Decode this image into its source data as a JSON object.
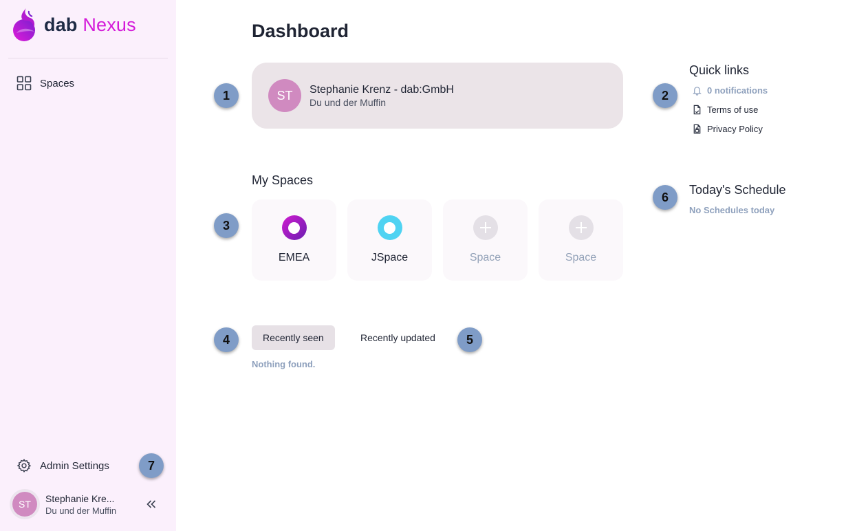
{
  "brand": {
    "name_part1": "dab",
    "name_part2": "Nexus"
  },
  "sidebar": {
    "nav": [
      {
        "label": "Spaces",
        "icon": "grid-icon"
      }
    ],
    "admin": {
      "label": "Admin Settings",
      "icon": "gear-icon"
    },
    "user": {
      "initials": "ST",
      "name": "Stephanie Kre...",
      "org": "Du und der Muffin"
    },
    "collapse_icon": "double-chevron-left-icon"
  },
  "main": {
    "title": "Dashboard",
    "profile": {
      "initials": "ST",
      "name": "Stephanie Krenz - dab:GmbH",
      "org": "Du und der Muffin"
    },
    "my_spaces": {
      "title": "My Spaces",
      "items": [
        {
          "label": "EMEA",
          "color": "#9b1fb2",
          "empty": false
        },
        {
          "label": "JSpace",
          "color": "#4fd3f2",
          "empty": false
        },
        {
          "label": "Space",
          "empty": true
        },
        {
          "label": "Space",
          "empty": true
        }
      ]
    },
    "tabs": [
      {
        "label": "Recently seen",
        "active": true
      },
      {
        "label": "Recently updated",
        "active": false
      }
    ],
    "empty_message": "Nothing found."
  },
  "right": {
    "quick_links": {
      "title": "Quick links",
      "items": [
        {
          "label": "0 notifications",
          "icon": "bell-icon"
        },
        {
          "label": "Terms of use",
          "icon": "document-icon"
        },
        {
          "label": "Privacy Policy",
          "icon": "lock-document-icon"
        }
      ]
    },
    "schedule": {
      "title": "Today's Schedule",
      "empty": "No Schedules today"
    }
  },
  "markers": [
    "1",
    "2",
    "3",
    "4",
    "5",
    "6",
    "7"
  ],
  "colors": {
    "sidebar_bg": "#fbf0fc",
    "accent": "#d41ad9",
    "marker": "#7f9cc7",
    "avatar": "#d08ac0"
  }
}
